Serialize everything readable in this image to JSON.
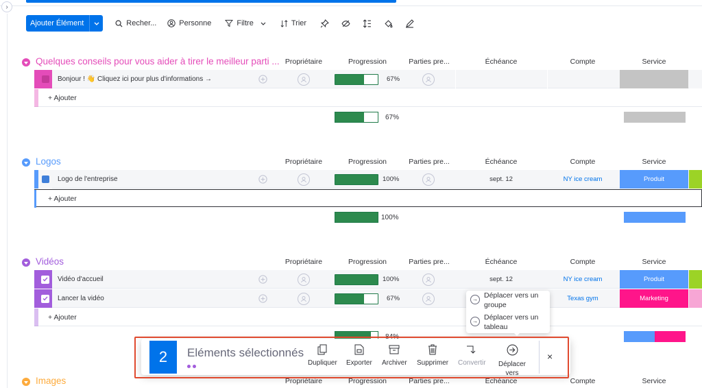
{
  "toolbar": {
    "add_button": "Ajouter Élément",
    "search": "Recher...",
    "person": "Personne",
    "filter": "Filtre",
    "sort": "Trier"
  },
  "columns": {
    "owner": "Propriétaire",
    "progress": "Progression",
    "stakeholders": "Parties pre...",
    "due": "Échéance",
    "account": "Compte",
    "service": "Service"
  },
  "add_item_label": "+ Ajouter",
  "colors": {
    "accent": "#0073ea",
    "pink": "#e44cb9",
    "blue": "#579bfc",
    "purple": "#a25ddc",
    "orange": "#fdab3d",
    "green": "#2d8a4e",
    "marketing": "#ff158a",
    "lime": "#9cd326"
  },
  "groups": [
    {
      "title": "Quelques conseils pour vous aider à tirer le meilleur parti ...",
      "rows": [
        {
          "name": "Bonjour ! 👋 Cliquez ici pour plus d'informations →",
          "progress": 67,
          "progress_label": "67%",
          "due": "",
          "account": "",
          "service": ""
        }
      ],
      "summary_progress": 67,
      "summary_label": "67%"
    },
    {
      "title": "Logos",
      "rows": [
        {
          "name": "Logo de l'entreprise",
          "progress": 100,
          "progress_label": "100%",
          "due": "sept. 12",
          "account": "NY ice cream",
          "service": "Produit"
        }
      ],
      "summary_progress": 100,
      "summary_label": "100%"
    },
    {
      "title": "Vidéos",
      "rows": [
        {
          "name": "Vidéo d'accueil",
          "progress": 100,
          "progress_label": "100%",
          "due": "sept. 12",
          "account": "NY ice cream",
          "service": "Produit"
        },
        {
          "name": "Lancer la vidéo",
          "progress": 67,
          "progress_label": "67%",
          "due": "",
          "account": "Texas gym",
          "service": "Marketing"
        }
      ],
      "summary_progress": 84,
      "summary_label": "84%"
    },
    {
      "title": "Images"
    }
  ],
  "move_menu": {
    "to_group": "Déplacer vers un groupe",
    "to_board": "Déplacer vers un tableau"
  },
  "selection_bar": {
    "count": "2",
    "label": "Eléments sélectionnés",
    "duplicate": "Dupliquer",
    "export": "Exporter",
    "archive": "Archiver",
    "delete": "Supprimer",
    "convert": "Convertir",
    "move": "Déplacer vers",
    "close": "×"
  }
}
